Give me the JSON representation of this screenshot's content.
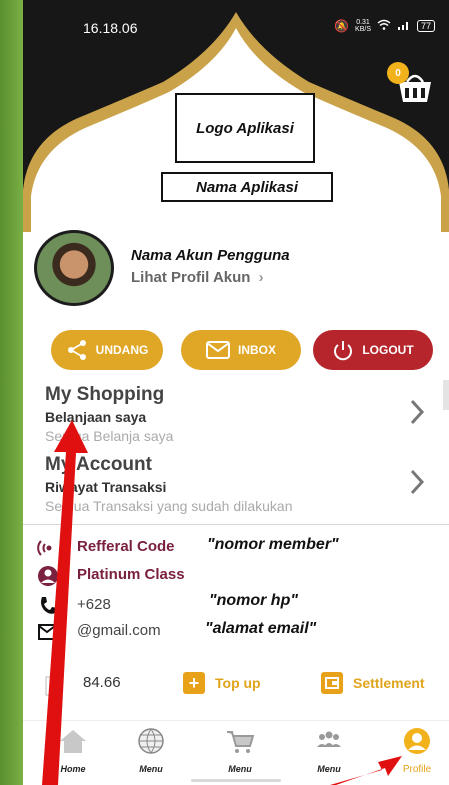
{
  "status_bar": {
    "time": "16.18.06",
    "speed_value": "0.31",
    "speed_unit": "KB/S",
    "battery": "77"
  },
  "header": {
    "logo_placeholder": "Logo Aplikasi",
    "app_name_placeholder": "Nama Aplikasi",
    "cart_count": "0"
  },
  "profile": {
    "account_name": "Nama Akun Pengguna",
    "view_profile": "Lihat Profil Akun",
    "view_profile_chevron": "›"
  },
  "actions": {
    "invite": "UNDANG",
    "inbox": "INBOX",
    "logout": "LOGOUT"
  },
  "menu": [
    {
      "title": "My Shopping",
      "subtitle": "Belanjaan saya",
      "description": "Semua Belanja saya"
    },
    {
      "title": "My Account",
      "subtitle": "Riwayat Transaksi",
      "description": "Semua Transaksi yang sudah dilakukan"
    }
  ],
  "member_info": {
    "referral_label": "Refferal Code",
    "referral_value": "\"nomor member\"",
    "class_label": "Platinum Class",
    "phone": "+628",
    "phone_value": "\"nomor hp\"",
    "email": "@gmail.com",
    "email_value": "\"alamat email\""
  },
  "wallet": {
    "balance": "84.66",
    "top_up": "Top up",
    "settlement": "Settlement"
  },
  "bottom_nav": {
    "items": [
      "Home",
      "Menu",
      "Menu",
      "Menu",
      "Profile"
    ]
  },
  "colors": {
    "gold": "#e0a626",
    "logout_red": "#b5252b",
    "header_black": "#171717",
    "arrow_red": "#e01010"
  }
}
